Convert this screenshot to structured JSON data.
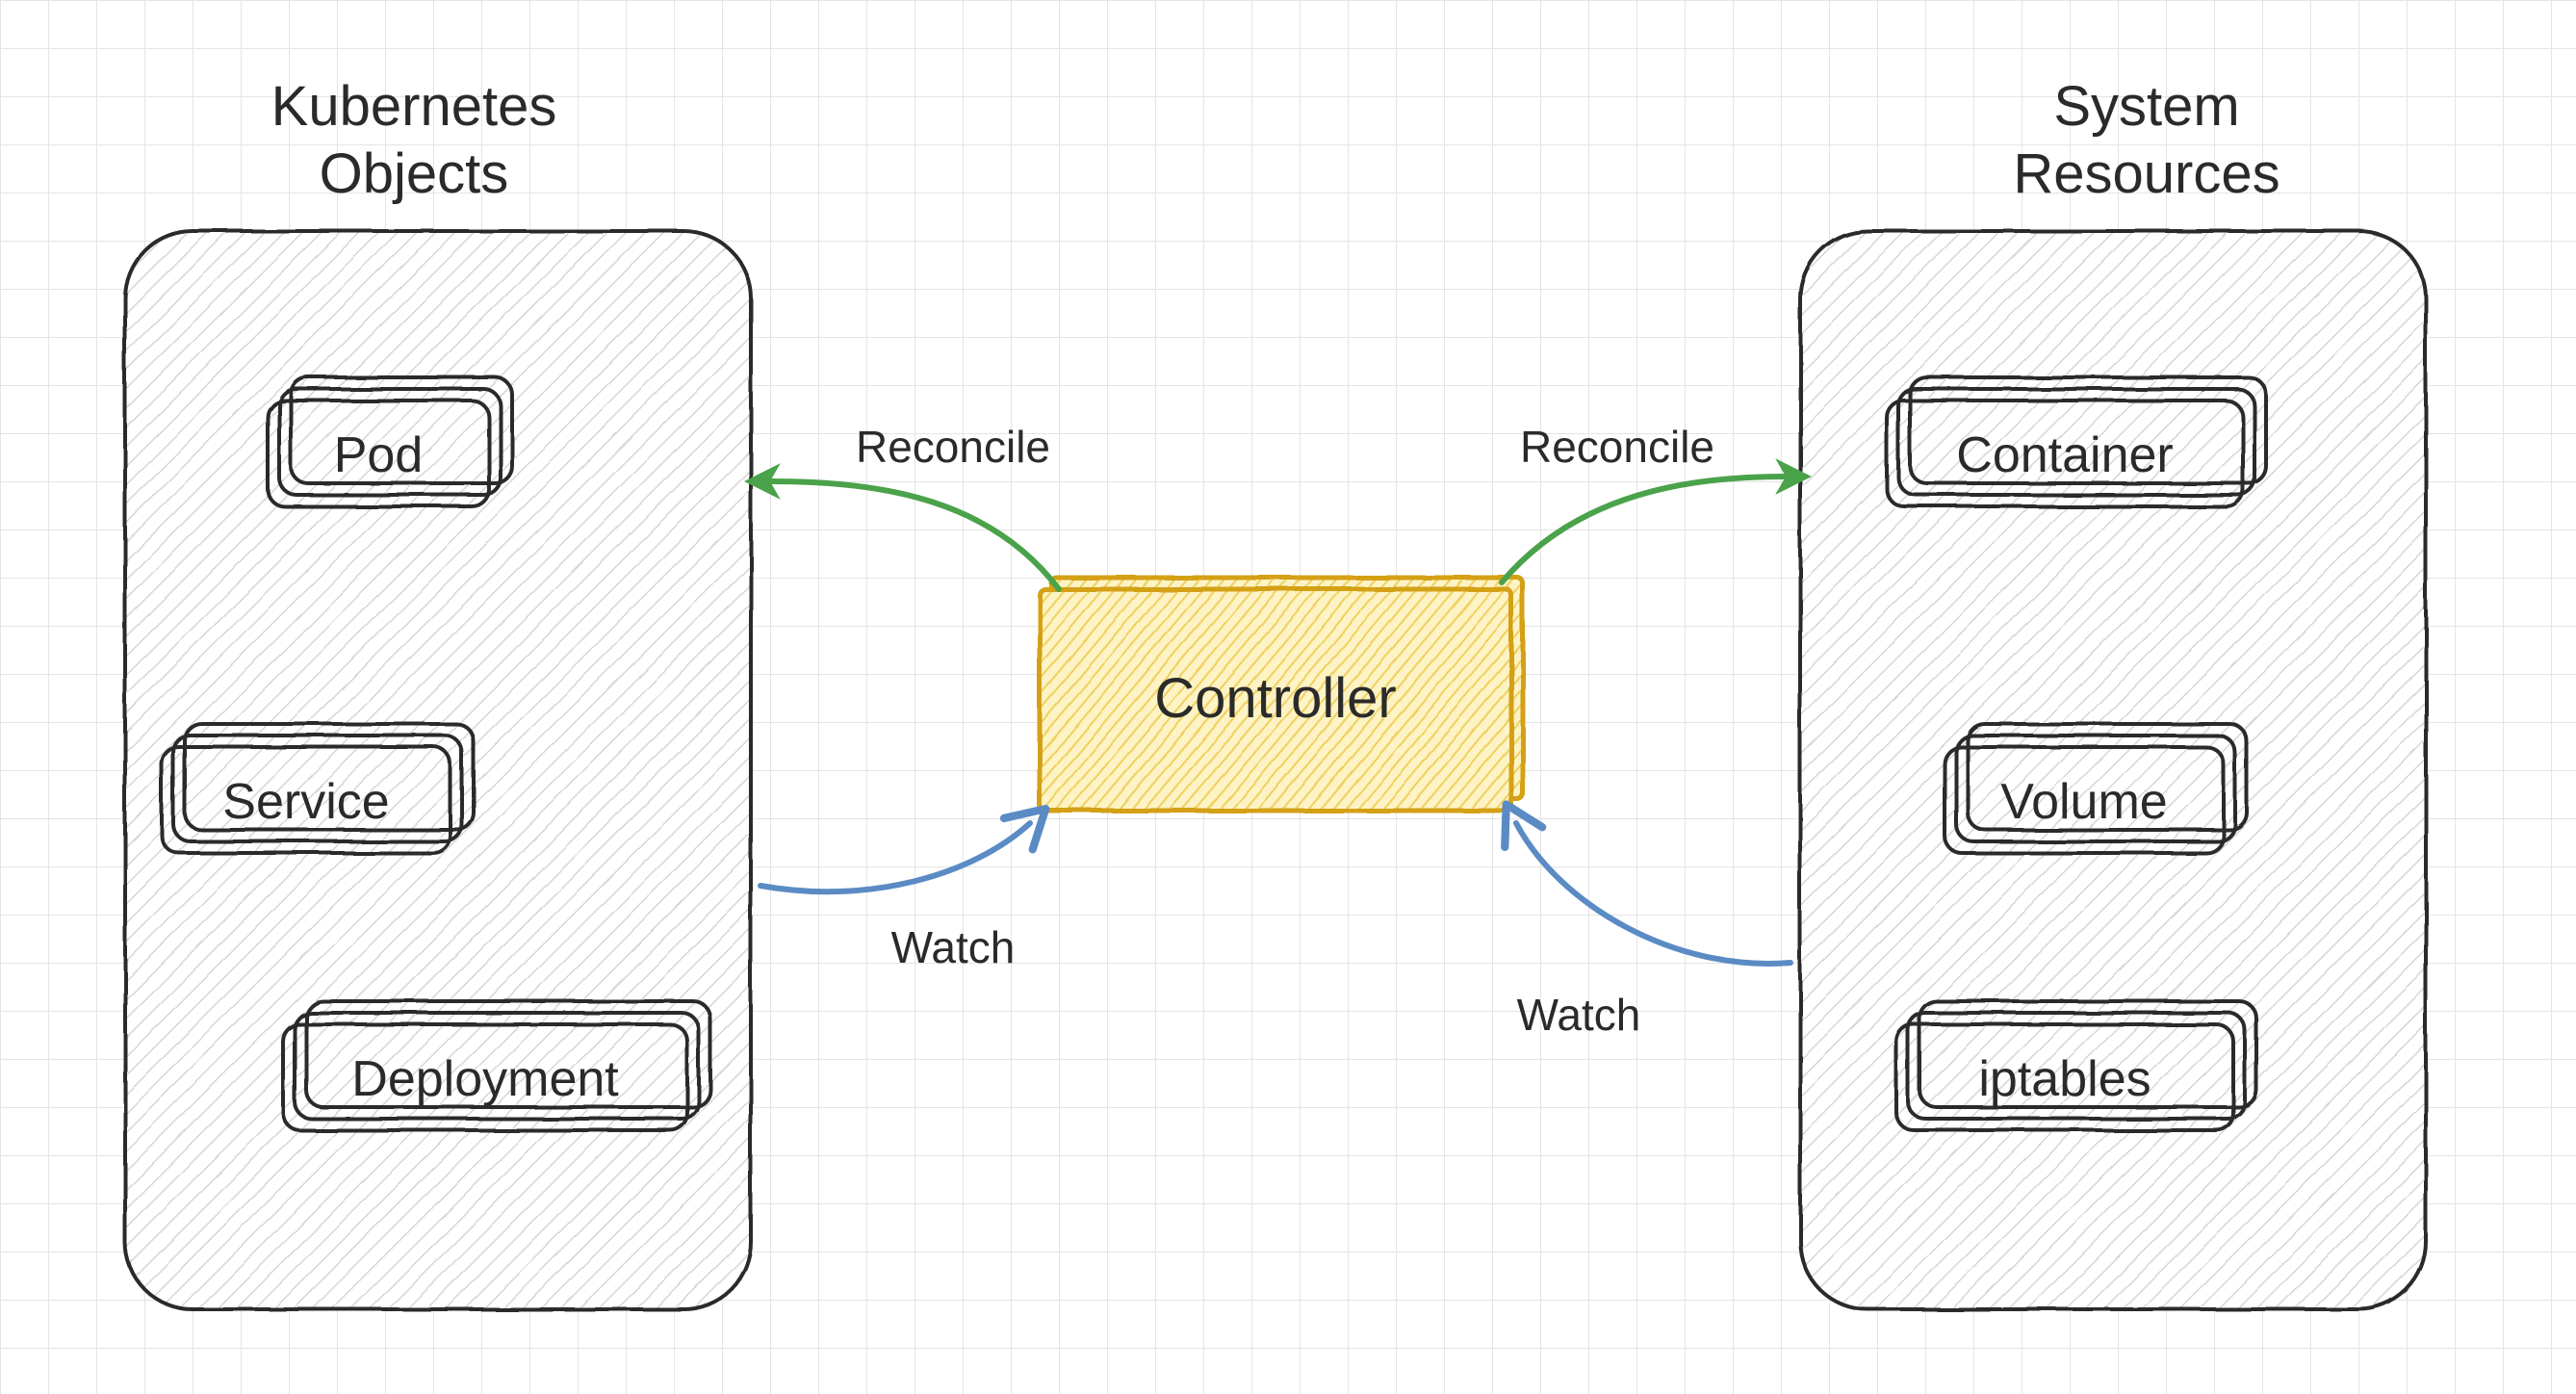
{
  "left_group": {
    "title_line1": "Kubernetes",
    "title_line2": "Objects",
    "items": [
      "Pod",
      "Service",
      "Deployment"
    ]
  },
  "right_group": {
    "title_line1": "System",
    "title_line2": "Resources",
    "items": [
      "Container",
      "Volume",
      "iptables"
    ]
  },
  "center_node": "Controller",
  "arrows": {
    "reconcile_left": "Reconcile",
    "reconcile_right": "Reconcile",
    "watch_left": "Watch",
    "watch_right": "Watch"
  },
  "colors": {
    "green": "#4aa24a",
    "blue": "#5b8bc4",
    "yellow_stroke": "#d4a017",
    "yellow_fill": "#f6e08a",
    "ink": "#2a2a2a",
    "grid": "#e4e4e4"
  }
}
